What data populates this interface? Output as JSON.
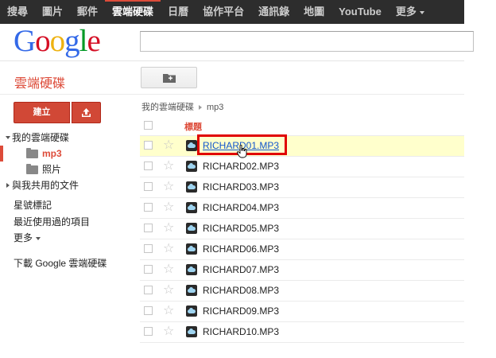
{
  "topbar": {
    "items": [
      "搜尋",
      "圖片",
      "郵件",
      "雲端硬碟",
      "日曆",
      "協作平台",
      "通訊錄",
      "地圖",
      "YouTube",
      "更多"
    ],
    "active_index": 3
  },
  "logo": {
    "text": "Google"
  },
  "app": {
    "title": "雲端硬碟",
    "create_label": "建立"
  },
  "sidebar": {
    "my_drive": "我的雲端硬碟",
    "folders": [
      "mp3",
      "照片"
    ],
    "shared": "與我共用的文件",
    "starred": "星號標記",
    "recent": "最近使用過的項目",
    "more": "更多",
    "download": "下載 Google 雲端硬碟"
  },
  "breadcrumb": {
    "root": "我的雲端硬碟",
    "current": "mp3"
  },
  "list": {
    "header_title": "標題",
    "files": [
      "RICHARD01.MP3",
      "RICHARD02.MP3",
      "RICHARD03.MP3",
      "RICHARD04.MP3",
      "RICHARD05.MP3",
      "RICHARD06.MP3",
      "RICHARD07.MP3",
      "RICHARD08.MP3",
      "RICHARD09.MP3",
      "RICHARD10.MP3"
    ]
  },
  "colors": {
    "accent": "#dd4b39",
    "highlight": "#ffffcc",
    "link": "#1155cc"
  }
}
